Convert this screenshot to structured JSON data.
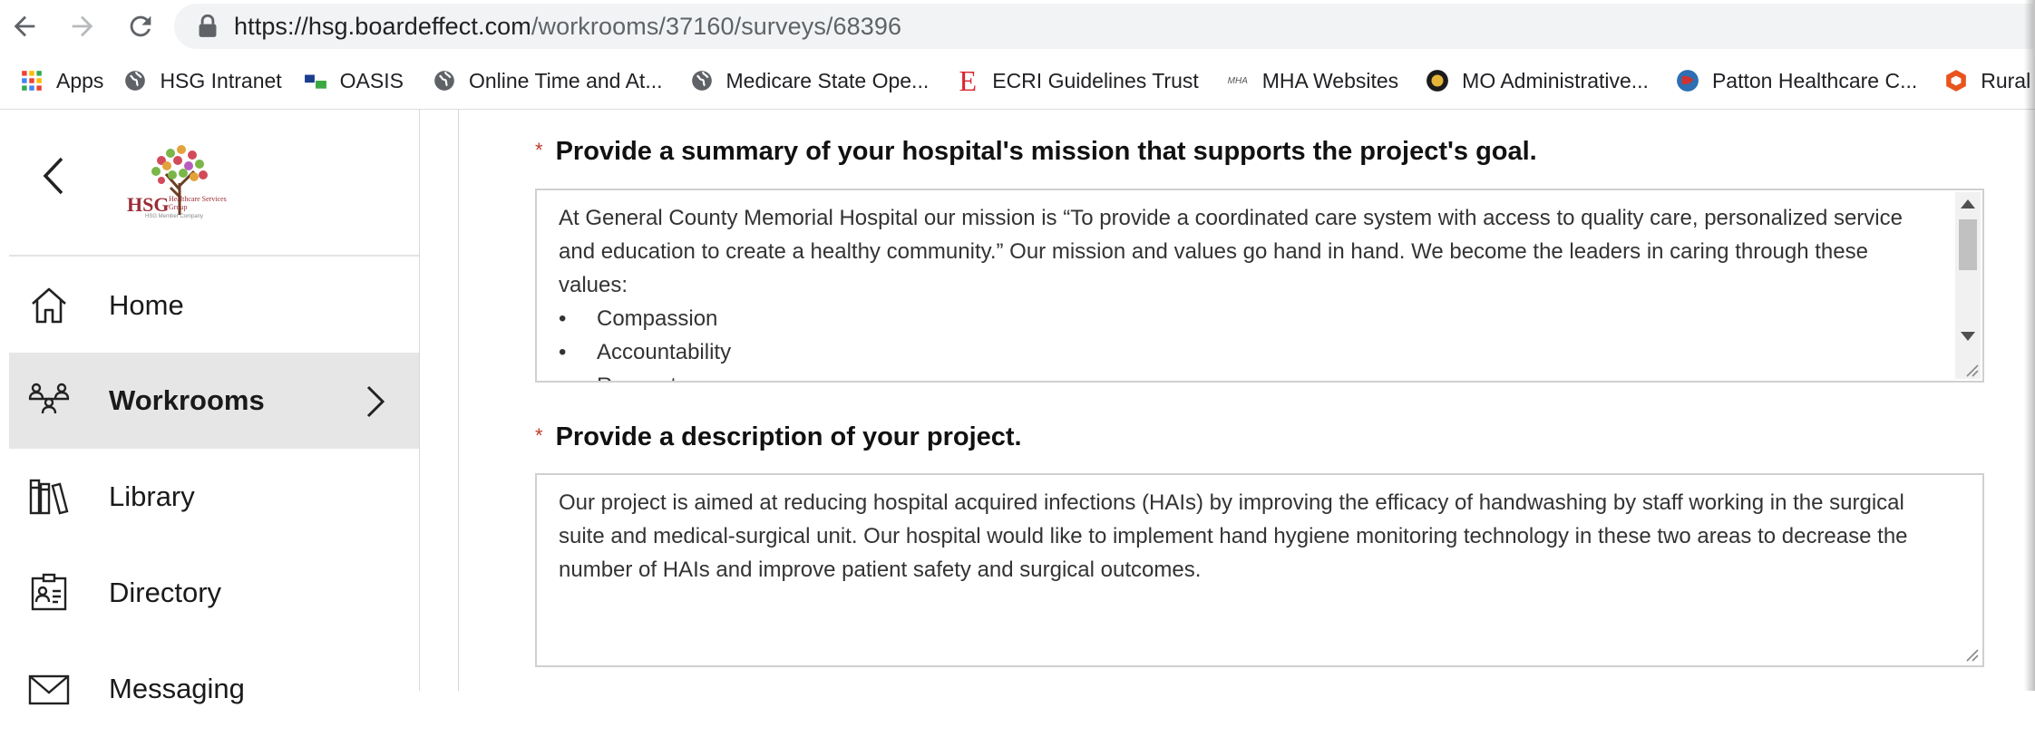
{
  "browser": {
    "url_host": "https://hsg.boardeffect.com",
    "url_path": "/workrooms/37160/surveys/68396",
    "bookmarks": [
      {
        "label": "Apps",
        "icon": "apps-grid-icon"
      },
      {
        "label": "HSG Intranet",
        "icon": "globe-icon"
      },
      {
        "label": "OASIS",
        "icon": "oasis-icon"
      },
      {
        "label": "Online Time and At...",
        "icon": "globe-icon"
      },
      {
        "label": "Medicare State Ope...",
        "icon": "globe-icon"
      },
      {
        "label": "ECRI Guidelines Trust",
        "icon": "ecri-icon"
      },
      {
        "label": "MHA Websites",
        "icon": "mha-icon"
      },
      {
        "label": "MO Administrative...",
        "icon": "mo-seal-icon"
      },
      {
        "label": "Patton Healthcare C...",
        "icon": "patton-icon"
      },
      {
        "label": "Rural H",
        "icon": "rural-icon"
      }
    ]
  },
  "sidebar": {
    "logo_text": "HSG",
    "logo_subtext": "Healthcare Services Group",
    "logo_tag": "HSG Member Company",
    "items": [
      {
        "label": "Home",
        "icon": "home-icon"
      },
      {
        "label": "Workrooms",
        "icon": "workrooms-icon",
        "active": true
      },
      {
        "label": "Library",
        "icon": "library-icon"
      },
      {
        "label": "Directory",
        "icon": "directory-icon"
      },
      {
        "label": "Messaging",
        "icon": "envelope-icon"
      }
    ]
  },
  "survey": {
    "required_marker": "*",
    "questions": [
      {
        "label": "Provide a summary of your hospital's mission that supports the project's goal.",
        "answer_paragraph": "At General County Memorial Hospital our mission is “To provide a coordinated care system with access to quality care, personalized service and education to create a healthy community.”  Our mission and values go hand in hand. We become the leaders in caring through these values:",
        "answer_bullets": [
          "Compassion",
          "Accountability",
          "Respect"
        ]
      },
      {
        "label": "Provide a description of your project.",
        "answer_paragraph": "Our project is aimed at reducing hospital acquired infections (HAIs) by improving the efficacy of handwashing by staff working in the surgical suite and medical-surgical unit.  Our hospital would like to implement hand hygiene monitoring technology in these two areas to decrease the number of HAIs and improve patient safety and surgical outcomes."
      }
    ]
  }
}
